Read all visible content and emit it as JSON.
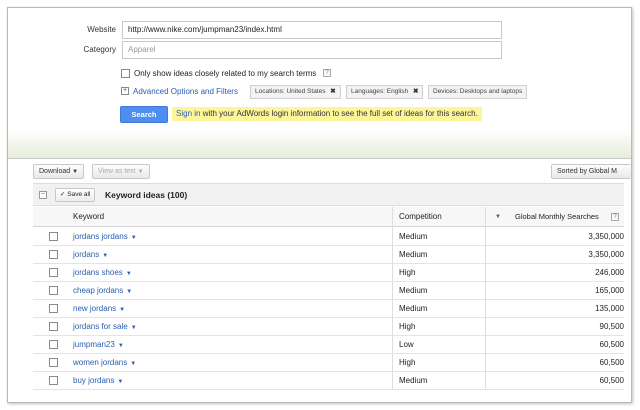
{
  "form": {
    "website_label": "Website",
    "website_value": "http://www.nike.com/jumpman23/index.html",
    "category_label": "Category",
    "category_placeholder": "Apparel",
    "only_show_label": "Only show ideas closely related to my search terms",
    "help_glyph": "?",
    "advanced_label": "Advanced Options and Filters",
    "filters": [
      {
        "key": "Locations:",
        "value": "United States",
        "close": "✖"
      },
      {
        "key": "Languages:",
        "value": "English",
        "close": "✖"
      },
      {
        "key": "Devices:",
        "value": "Desktops and laptops"
      }
    ],
    "search_button": "Search",
    "signin_link": "Sign in",
    "signin_text": "with your AdWords login information to see the full set of ideas for this search."
  },
  "toolbar": {
    "download_label": "Download",
    "view_as_text_label": "View as text",
    "sorted_by_label": "Sorted by Global M"
  },
  "group": {
    "save_all_label": "Save all",
    "title": "Keyword ideas (100)"
  },
  "table": {
    "columns": {
      "keyword": "Keyword",
      "competition": "Competition",
      "global_monthly": "Global Monthly Searches"
    },
    "rows": [
      {
        "keyword": "jordans jordans",
        "competition": "Medium",
        "searches": "3,350,000"
      },
      {
        "keyword": "jordans",
        "competition": "Medium",
        "searches": "3,350,000"
      },
      {
        "keyword": "jordans shoes",
        "competition": "High",
        "searches": "246,000"
      },
      {
        "keyword": "cheap jordans",
        "competition": "Medium",
        "searches": "165,000"
      },
      {
        "keyword": "new jordans",
        "competition": "Medium",
        "searches": "135,000"
      },
      {
        "keyword": "jordans for sale",
        "competition": "High",
        "searches": "90,500"
      },
      {
        "keyword": "jumpman23",
        "competition": "Low",
        "searches": "60,500"
      },
      {
        "keyword": "women jordans",
        "competition": "High",
        "searches": "60,500"
      },
      {
        "keyword": "buy jordans",
        "competition": "Medium",
        "searches": "60,500"
      }
    ]
  },
  "colors": {
    "link": "#2a5db0",
    "search_button": "#4d8ef0",
    "signin_highlight": "#fdf59a"
  }
}
